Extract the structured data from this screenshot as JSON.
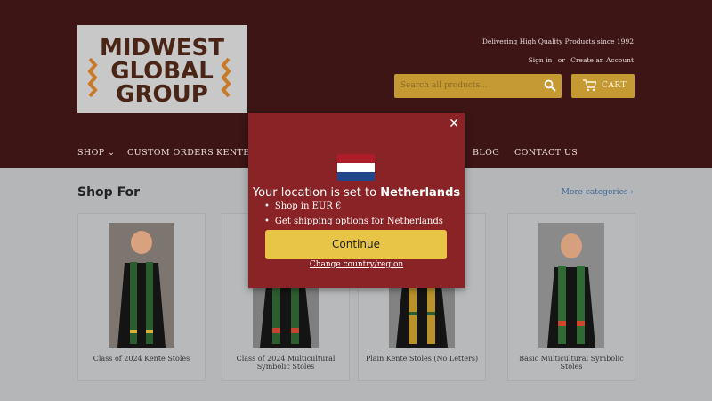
{
  "header": {
    "logo_lines": [
      "MIDWEST",
      "GLOBAL",
      "GROUP"
    ],
    "tagline": "Delivering High Quality Products since 1992",
    "sign_in": "Sign in",
    "or": "or",
    "create_account": "Create an Account",
    "search_placeholder": "Search all products...",
    "cart_label": "CART"
  },
  "nav": {
    "shop": "SHOP",
    "custom_orders": "CUSTOM ORDERS",
    "kente": "KENTE",
    "blog": "BLOG",
    "contact": "CONTACT US"
  },
  "section": {
    "title": "Shop For",
    "more": "More categories ›"
  },
  "products": [
    {
      "caption": "Class of 2024 Kente Stoles"
    },
    {
      "caption": "Class of 2024 Multicultural Symbolic Stoles"
    },
    {
      "caption": "Plain Kente Stoles (No Letters)"
    },
    {
      "caption": "Basic Multicultural Symbolic Stoles"
    }
  ],
  "modal": {
    "close_glyph": "✕",
    "location_prefix": "Your location is set to",
    "country": "Netherlands",
    "bullet1": "Shop in EUR €",
    "bullet2": "Get shipping options for Netherlands",
    "continue": "Continue",
    "change": "Change country/region"
  },
  "colors": {
    "header_bg": "#3c1514",
    "accent": "#c69a33",
    "modal_bg": "#8a2325",
    "button": "#e8c546"
  }
}
